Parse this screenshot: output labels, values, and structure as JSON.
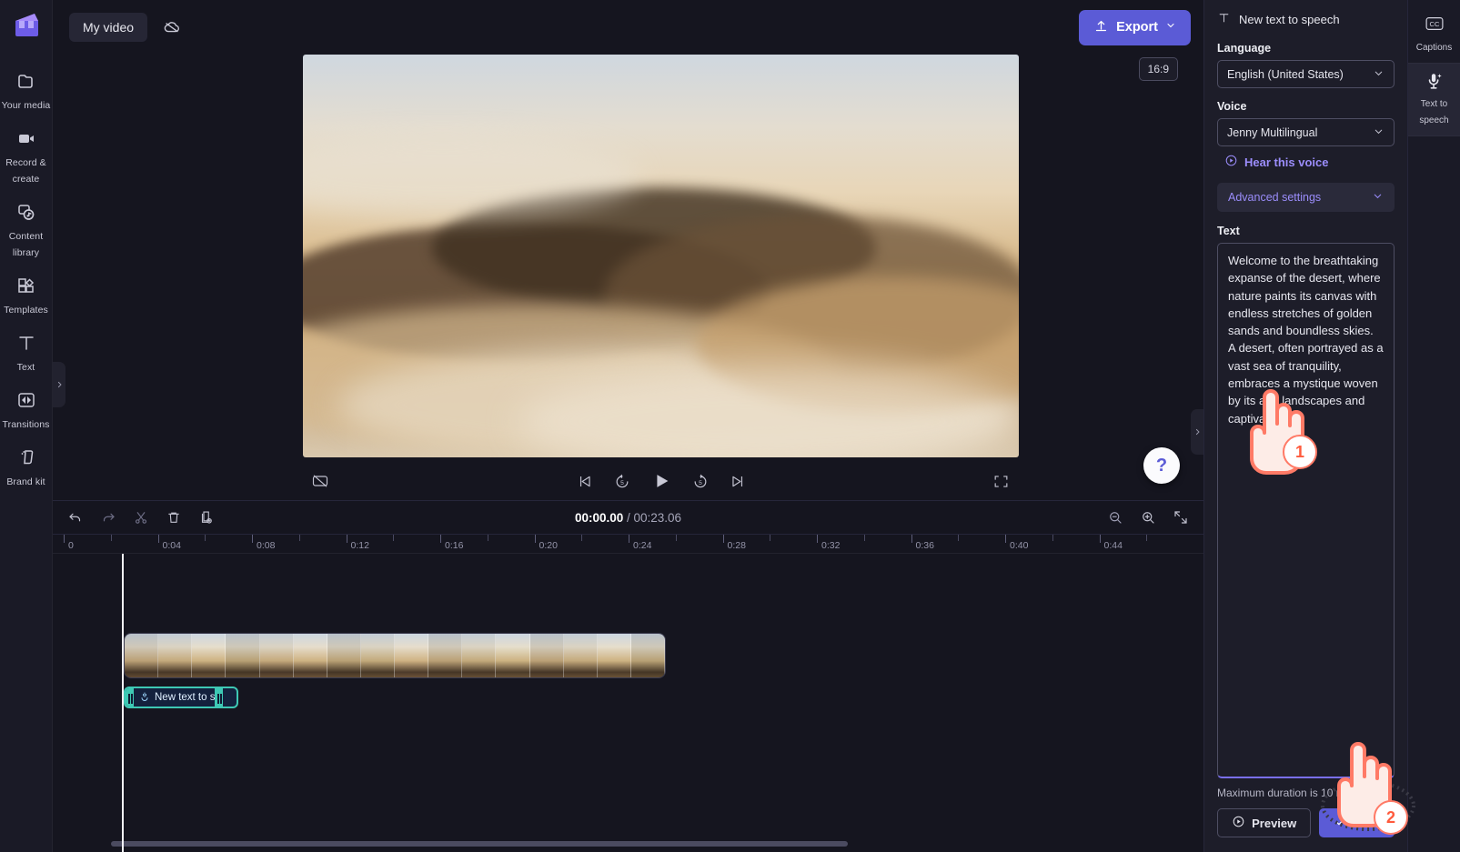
{
  "app": {
    "logo_icon": "clipchamp-logo-icon"
  },
  "left_rail": {
    "items": [
      {
        "label": "Your media",
        "icon": "folder-icon"
      },
      {
        "label": "Record & create",
        "icon": "video-camera-icon"
      },
      {
        "label": "Content library",
        "icon": "content-library-icon"
      },
      {
        "label": "Templates",
        "icon": "templates-icon"
      },
      {
        "label": "Text",
        "icon": "text-t-icon"
      },
      {
        "label": "Transitions",
        "icon": "transitions-icon"
      },
      {
        "label": "Brand kit",
        "icon": "brand-kit-icon"
      }
    ]
  },
  "topbar": {
    "project_name": "My video",
    "cloud_icon": "cloud-off-icon",
    "export_label": "Export",
    "export_icon": "upload-arrow-icon",
    "export_caret": "chevron-down-icon"
  },
  "stage": {
    "aspect_ratio": "16:9",
    "help_label": "?",
    "controls": {
      "captions_icon": "captions-off-icon",
      "prev_icon": "skip-to-start-icon",
      "back5_icon": "rewind-5-icon",
      "play_icon": "play-icon",
      "fwd5_icon": "forward-5-icon",
      "next_icon": "skip-to-end-icon",
      "fullscreen_icon": "fullscreen-icon"
    },
    "collapse_left_icon": "chevron-right-icon",
    "collapse_right_icon": "chevron-right-icon"
  },
  "timeline": {
    "tools": [
      {
        "name": "undo",
        "icon": "undo-icon"
      },
      {
        "name": "redo",
        "icon": "redo-icon"
      },
      {
        "name": "split",
        "icon": "scissors-icon"
      },
      {
        "name": "delete",
        "icon": "trash-icon"
      },
      {
        "name": "duplicate",
        "icon": "duplicate-icon"
      }
    ],
    "current_time": "00:00.00",
    "time_separator": " / ",
    "total_time": "00:23.06",
    "zoom_controls": [
      {
        "name": "zoom-out",
        "icon": "zoom-out-icon"
      },
      {
        "name": "zoom-in",
        "icon": "zoom-in-icon"
      },
      {
        "name": "fit-to-screen",
        "icon": "fit-screen-icon"
      }
    ],
    "ruler_labels": [
      "0",
      "0:04",
      "0:08",
      "0:12",
      "0:16",
      "0:20",
      "0:24",
      "0:28",
      "0:32",
      "0:36",
      "0:40",
      "0:44"
    ],
    "video_clip": {
      "name": "desert-video-clip",
      "thumbnails": 16
    },
    "audio_clip": {
      "label": "New text to s",
      "icon": "text-to-speech-icon"
    }
  },
  "properties": {
    "header_title": "New text to speech",
    "header_icon": "text-t-icon",
    "language_label": "Language",
    "language_value": "English (United States)",
    "voice_label": "Voice",
    "voice_value": "Jenny Multilingual",
    "hear_voice_label": "Hear this voice",
    "hear_voice_icon": "play-circle-icon",
    "advanced_label": "Advanced settings",
    "advanced_icon": "chevron-down-icon",
    "text_label": "Text",
    "text_value": "Welcome to the breathtaking expanse of the desert, where nature paints its canvas with endless stretches of golden sands and boundless skies. A desert, often portrayed as a vast sea of tranquility, embraces a mystique woven by its arid landscapes and captivating",
    "max_duration_hint": "Maximum duration is 10 min",
    "preview_label": "Preview",
    "preview_icon": "play-circle-icon",
    "save_label": "Save",
    "save_icon": "checkmark-icon",
    "dropdown_icon": "chevron-down-icon"
  },
  "tab_rail": {
    "tabs": [
      {
        "label": "Captions",
        "icon": "cc-icon",
        "active": false
      },
      {
        "label": "Text to speech",
        "icon": "text-to-speech-icon",
        "active": true
      }
    ]
  },
  "annotations": [
    {
      "number": "1",
      "name": "cursor-step-1"
    },
    {
      "number": "2",
      "name": "cursor-step-2"
    }
  ],
  "colors": {
    "accent": "#5b5bd6",
    "link": "#9b8dfb",
    "audio_clip": "#3ec8b4",
    "cursor_outline": "#ff7a66",
    "panel_bg": "#1d1d29"
  }
}
